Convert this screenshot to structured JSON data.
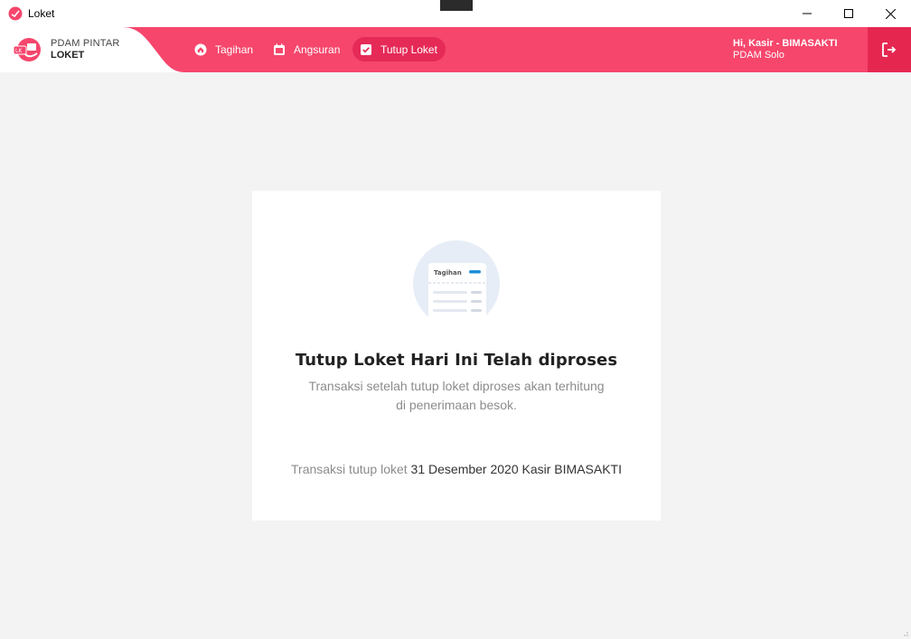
{
  "window": {
    "title": "Loket",
    "controls": [
      "minimize-icon",
      "maximize-icon",
      "close-icon"
    ]
  },
  "brand": {
    "line1": "PDAM PINTAR",
    "line2": "LOKET",
    "logo_icon": "loket-logo-icon"
  },
  "nav": {
    "items": [
      {
        "label": "Tagihan",
        "icon": "home-icon",
        "active": false
      },
      {
        "label": "Angsuran",
        "icon": "calendar-icon",
        "active": false
      },
      {
        "label": "Tutup Loket",
        "icon": "check-square-icon",
        "active": true
      }
    ]
  },
  "user": {
    "greeting": "Hi, Kasir - BIMASAKTI",
    "organization": "PDAM Solo"
  },
  "logout_icon": "logout-icon",
  "card": {
    "illustration_label": "Tagihan",
    "title": "Tutup Loket Hari Ini Telah diproses",
    "description": "Transaksi setelah tutup loket diproses akan terhitung di penerimaan besok.",
    "footer_prefix": "Transaksi tutup loket",
    "footer_detail": "31 Desember 2020 Kasir BIMASAKTI"
  },
  "colors": {
    "primary": "#f6466c",
    "primary_dark": "#e52a57",
    "background": "#f3f3f3",
    "card": "#ffffff"
  }
}
